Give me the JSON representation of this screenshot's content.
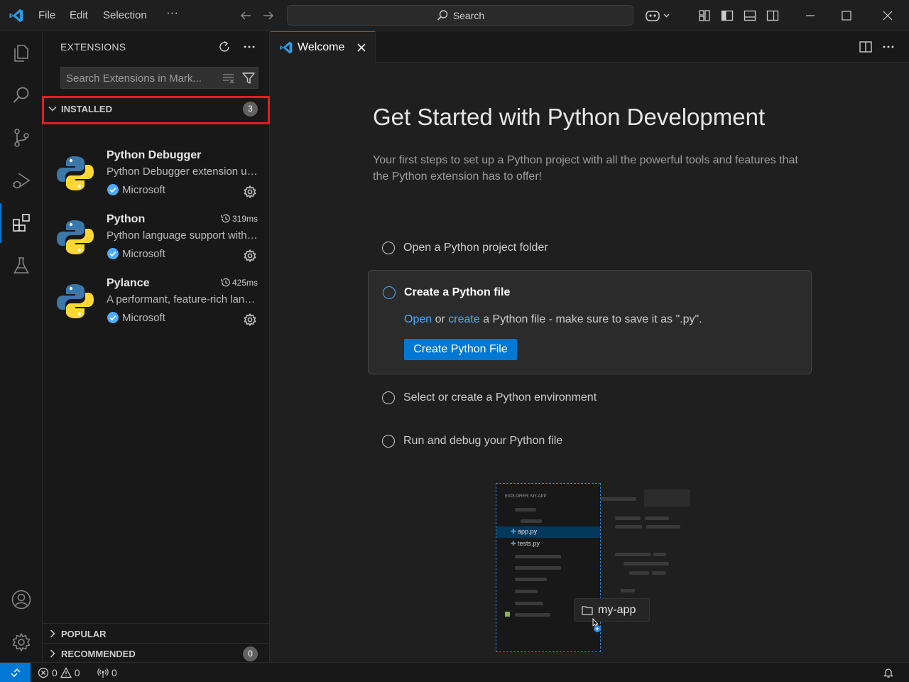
{
  "titlebar": {
    "menu": [
      "File",
      "Edit",
      "Selection",
      "···"
    ],
    "search_label": "Search"
  },
  "sidebar": {
    "title": "EXTENSIONS",
    "search_placeholder": "Search Extensions in Mark...",
    "installed": {
      "label": "INSTALLED",
      "count": "3"
    },
    "extensions": [
      {
        "name": "Python Debugger",
        "description": "Python Debugger extension using debugpy.",
        "publisher": "Microsoft",
        "time": ""
      },
      {
        "name": "Python",
        "description": "Python language support with extension access points",
        "publisher": "Microsoft",
        "time": "319ms"
      },
      {
        "name": "Pylance",
        "description": "A performant, feature-rich language server for Python",
        "publisher": "Microsoft",
        "time": "425ms"
      }
    ],
    "popular": {
      "label": "POPULAR"
    },
    "recommended": {
      "label": "RECOMMENDED",
      "count": "0"
    }
  },
  "editor": {
    "tab_label": "Welcome",
    "title": "Get Started with Python Development",
    "subtitle": "Your first steps to set up a Python project with all the powerful tools and features that the Python extension has to offer!",
    "steps": [
      {
        "label": "Open a Python project folder"
      },
      {
        "label": "Create a Python file"
      },
      {
        "label": "Select or create a Python environment"
      },
      {
        "label": "Run and debug your Python file"
      }
    ],
    "step_desc": {
      "open": "Open",
      "or": "or",
      "create": "create",
      "rest": "a Python file - make sure to save it as \".py\"."
    },
    "create_button": "Create Python File",
    "illustration": {
      "explorer_title": "EXPLORER: MY-APP",
      "file1": "app.py",
      "file2": "tests.py",
      "folder": "my-app"
    }
  },
  "statusbar": {
    "errors": "0",
    "warnings": "0",
    "ports": "0"
  },
  "colors": {
    "accent": "#0078d4",
    "highlight": "#e51c23",
    "link": "#4daafc"
  }
}
